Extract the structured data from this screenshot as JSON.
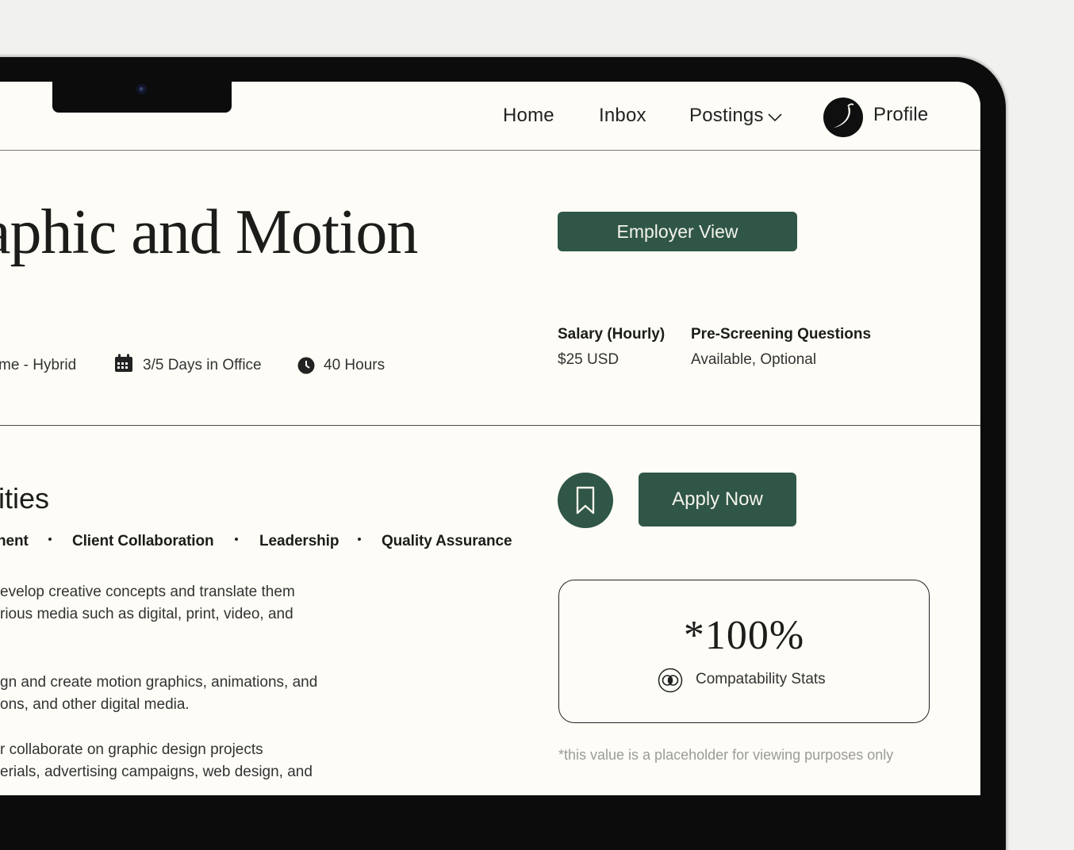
{
  "nav": {
    "home": "Home",
    "inbox": "Inbox",
    "postings": "Postings",
    "profile": "Profile"
  },
  "job": {
    "title_partial": "aphic and Motion",
    "employer_view_label": "Employer View",
    "meta": {
      "work_type": "me - Hybrid",
      "office_days": "3/5 Days in Office",
      "hours": "40 Hours"
    },
    "salary": {
      "label": "Salary (Hourly)",
      "value": "$25 USD"
    },
    "prescreening": {
      "label": "Pre-Screening Questions",
      "value": "Available, Optional"
    }
  },
  "responsibilities": {
    "title_partial": "lities",
    "skills": [
      "nent",
      "Client Collaboration",
      "Leadership",
      "Quality Assurance"
    ],
    "lines": [
      "evelop creative concepts and translate them",
      "rious media such as digital, print, video, and",
      "gn and create motion graphics, animations, and",
      "ons, and other digital media.",
      "r collaborate on graphic design projects",
      "erials, advertising campaigns, web design, and"
    ]
  },
  "actions": {
    "apply_label": "Apply Now"
  },
  "stats": {
    "value": "*100%",
    "label": "Compatability Stats",
    "footnote": "*this value is a placeholder for viewing purposes only"
  },
  "colors": {
    "accent": "#2f5647",
    "screen_bg": "#fdfcf6",
    "page_bg": "#f1f1f0"
  },
  "icons": {
    "calendar": "calendar-icon",
    "clock": "clock-icon",
    "bookmark": "bookmark-icon",
    "chevron": "chevron-down-icon",
    "stats": "compatibility-icon"
  }
}
